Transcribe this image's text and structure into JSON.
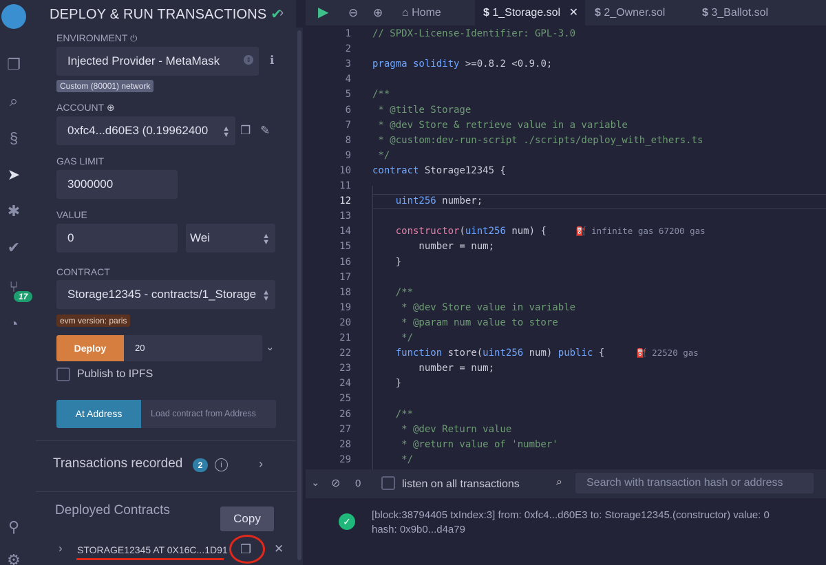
{
  "panel": {
    "title": "DEPLOY & RUN TRANSACTIONS",
    "environment_label": "ENVIRONMENT",
    "environment_value": "Injected Provider - MetaMask",
    "network_badge": "Custom (80001) network",
    "account_label": "ACCOUNT",
    "account_value": "0xfc4...d60E3 (0.19962400",
    "gas_limit_label": "GAS LIMIT",
    "gas_limit_value": "3000000",
    "value_label": "VALUE",
    "value_amount": "0",
    "value_unit": "Wei",
    "contract_label": "CONTRACT",
    "contract_value": "Storage12345 - contracts/1_Storage",
    "evm_badge": "evm version: paris",
    "deploy_label": "Deploy",
    "deploy_arg": "20",
    "publish_ipfs_label": "Publish to IPFS",
    "at_address_label": "At Address",
    "load_contract_placeholder": "Load contract from Address",
    "transactions_recorded_label": "Transactions recorded",
    "transactions_recorded_count": "2",
    "deployed_contracts_label": "Deployed Contracts",
    "deployed_instance_label": "STORAGE12345 AT 0X16C...1D91",
    "copy_tooltip": "Copy"
  },
  "rail": {
    "git_badge": "17"
  },
  "tabs": [
    {
      "label": "Home"
    },
    {
      "label": "1_Storage.sol"
    },
    {
      "label": "2_Owner.sol"
    },
    {
      "label": "3_Ballot.sol"
    }
  ],
  "editor": {
    "current_line": 12,
    "lines": [
      {
        "n": "1",
        "text": "// SPDX-License-Identifier: GPL-3.0"
      },
      {
        "n": "2",
        "text": ""
      },
      {
        "n": "3",
        "text": "pragma solidity >=0.8.2 <0.9.0;"
      },
      {
        "n": "4",
        "text": ""
      },
      {
        "n": "5",
        "text": "/**"
      },
      {
        "n": "6",
        "text": " * @title Storage"
      },
      {
        "n": "7",
        "text": " * @dev Store & retrieve value in a variable"
      },
      {
        "n": "8",
        "text": " * @custom:dev-run-script ./scripts/deploy_with_ethers.ts"
      },
      {
        "n": "9",
        "text": " */"
      },
      {
        "n": "10",
        "text": "contract Storage12345 {"
      },
      {
        "n": "11",
        "text": ""
      },
      {
        "n": "12",
        "text": "    uint256 number;"
      },
      {
        "n": "13",
        "text": ""
      },
      {
        "n": "14",
        "text": "    constructor(uint256 num) {"
      },
      {
        "n": "15",
        "text": "        number = num;"
      },
      {
        "n": "16",
        "text": "    }"
      },
      {
        "n": "17",
        "text": ""
      },
      {
        "n": "18",
        "text": "    /**"
      },
      {
        "n": "19",
        "text": "     * @dev Store value in variable"
      },
      {
        "n": "20",
        "text": "     * @param num value to store"
      },
      {
        "n": "21",
        "text": "     */"
      },
      {
        "n": "22",
        "text": "    function store(uint256 num) public {"
      },
      {
        "n": "23",
        "text": "        number = num;"
      },
      {
        "n": "24",
        "text": "    }"
      },
      {
        "n": "25",
        "text": ""
      },
      {
        "n": "26",
        "text": "    /**"
      },
      {
        "n": "27",
        "text": "     * @dev Return value"
      },
      {
        "n": "28",
        "text": "     * @return value of 'number'"
      },
      {
        "n": "29",
        "text": "     */"
      }
    ],
    "gas_hint_constructor": "infinite gas 67200 gas",
    "gas_hint_store": "22520 gas"
  },
  "terminal": {
    "pending_count": "0",
    "listen_label": "listen on all transactions",
    "search_placeholder": "Search with transaction hash or address",
    "log_line1": "[block:38794405 txIndex:3]  from: 0xfc4...d60E3  to: Storage12345.(constructor)  value: 0",
    "log_line2": "hash: 0x9b0...d4a79"
  },
  "colors": {
    "deploy_button": "#d57e3f",
    "at_address_button": "#2f7fa8",
    "success": "#1fb87a",
    "annotation_red": "#e0281b"
  }
}
